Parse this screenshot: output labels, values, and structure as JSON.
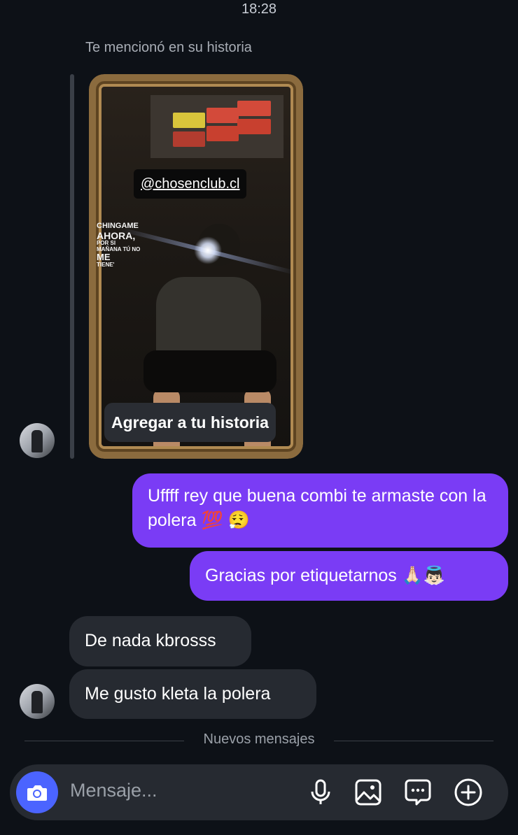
{
  "status_bar": {
    "time": "18:28"
  },
  "story_reply": {
    "mention_text": "Te mencionó en su historia",
    "mention_tag": "@chosenclub.cl",
    "sticker_lines": [
      "CHINGAME",
      "AHORA,",
      "POR SI",
      "MAÑANA TÚ NO",
      "ME",
      "TIENE'"
    ],
    "add_to_story_label": "Agregar a tu historia"
  },
  "messages": [
    {
      "direction": "sent",
      "text": "Uffff rey que buena combi te armaste con la polera 💯 😮‍💨"
    },
    {
      "direction": "sent",
      "text": "Gracias por etiquetarnos 🙏🏻👼🏻"
    },
    {
      "direction": "received",
      "text": "De nada kbrosss"
    },
    {
      "direction": "received",
      "text": "Me gusto kleta la polera"
    }
  ],
  "divider": {
    "label": "Nuevos mensajes"
  },
  "composer": {
    "placeholder": "Mensaje...",
    "icons": [
      "camera-icon",
      "microphone-icon",
      "gallery-icon",
      "sticker-icon",
      "add-icon"
    ]
  },
  "colors": {
    "background": "#0d1117",
    "sent_bubble": "#7a3cf5",
    "received_bubble": "#262a31",
    "camera_button": "#4b64ff"
  }
}
